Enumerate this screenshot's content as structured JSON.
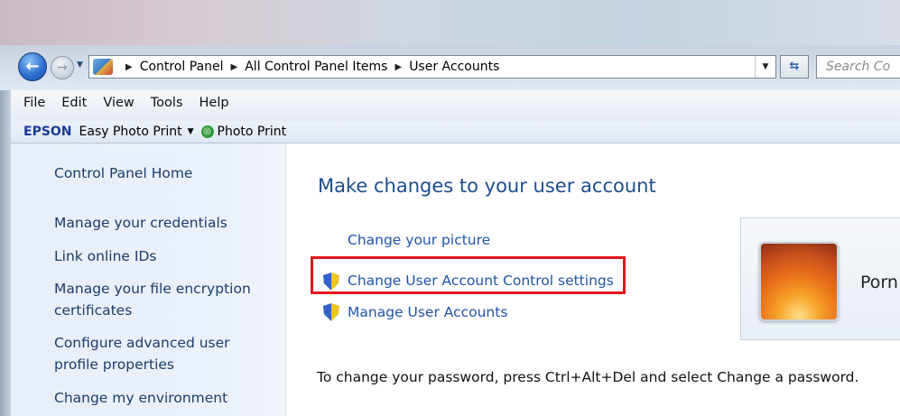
{
  "address_bar": {
    "breadcrumbs": [
      "Control Panel",
      "All Control Panel Items",
      "User Accounts"
    ],
    "search_placeholder": "Search Co"
  },
  "menu": [
    "File",
    "Edit",
    "View",
    "Tools",
    "Help"
  ],
  "toolbar": {
    "brand": "EPSON",
    "item1": "Easy Photo Print",
    "item2": "Photo Print"
  },
  "sidebar": {
    "items": [
      "Control Panel Home",
      "Manage your credentials",
      "Link online IDs",
      "Manage your file encryption",
      "certificates",
      "Configure advanced user",
      "profile properties",
      "Change my environment"
    ]
  },
  "main": {
    "heading": "Make changes to your user account",
    "link_picture": "Change your picture",
    "link_uac": "Change User Account Control settings",
    "link_manage": "Manage User Accounts",
    "info_text": "To change your password, press Ctrl+Alt+Del and select Change a password.",
    "profile_name": "Porn"
  },
  "colors": {
    "highlight_border": "#e0151c",
    "link": "#1f55a8",
    "heading": "#1f4d8f"
  }
}
